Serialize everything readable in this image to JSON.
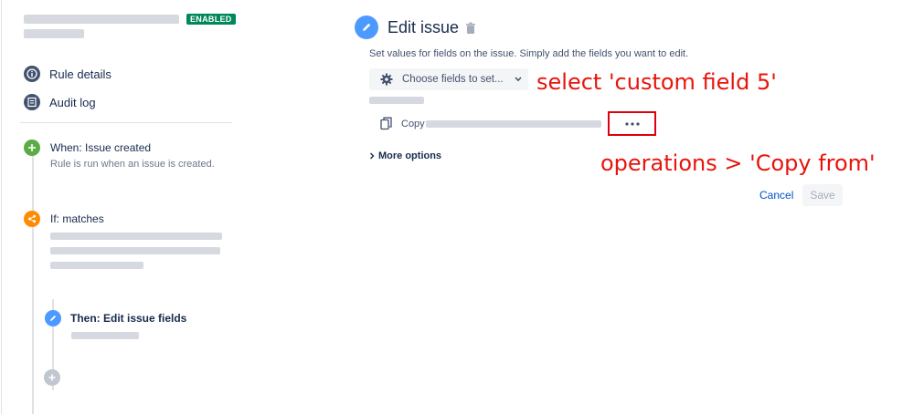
{
  "sidebar": {
    "badge": "ENABLED",
    "links": [
      {
        "label": "Rule details",
        "icon": "info-icon"
      },
      {
        "label": "Audit log",
        "icon": "list-icon"
      }
    ],
    "steps": [
      {
        "title": "When: Issue created",
        "subtitle": "Rule is run when an issue is created.",
        "color": "#5aac44"
      },
      {
        "title": "If: matches",
        "color": "#ff8b00"
      },
      {
        "title": "Then: Edit issue fields",
        "color": "#4c9aff"
      }
    ]
  },
  "panel": {
    "title": "Edit issue",
    "description": "Set values for fields on the issue. Simply add the fields you want to edit.",
    "choose_fields_label": "Choose fields to set...",
    "copy_label": "Copy",
    "more_options": "More options",
    "cancel": "Cancel",
    "save": "Save"
  },
  "annotations": {
    "select": "select 'custom field 5'",
    "operations": "operations > 'Copy from'"
  },
  "colors": {
    "accent": "#4c9aff",
    "annotation": "#e8140c",
    "badge": "#00875a"
  }
}
